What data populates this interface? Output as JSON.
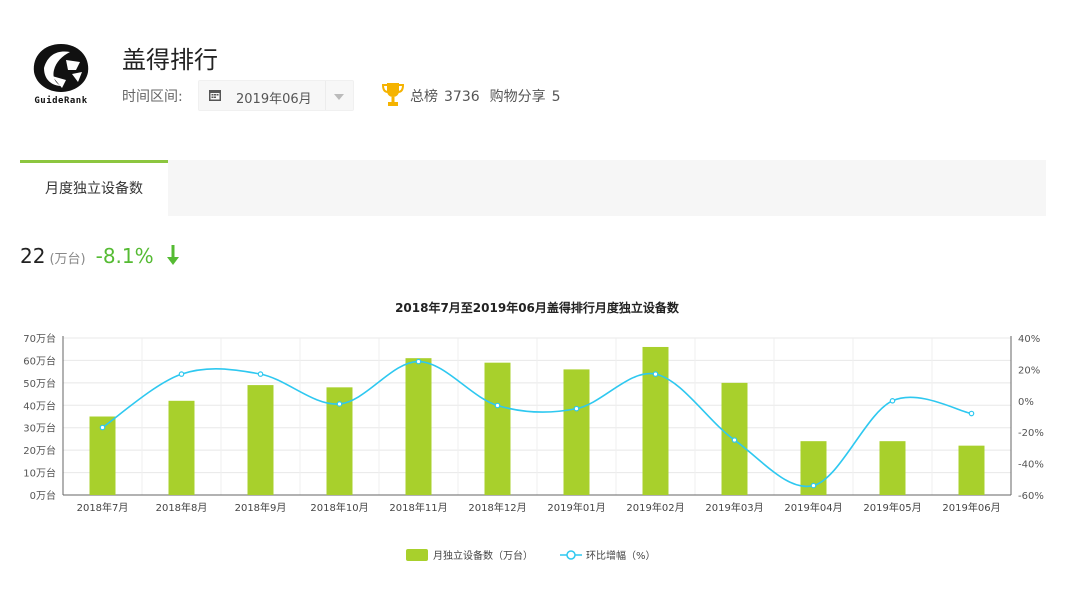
{
  "app": {
    "name": "盖得排行",
    "logo_text": "GuideRank"
  },
  "filter": {
    "label": "时间区间:",
    "date_value": "2019年06月",
    "calendar_icon": "calendar-icon",
    "dropdown_icon": "caret-down-icon"
  },
  "rank": {
    "icon": "trophy-icon",
    "total_label": "总榜",
    "total_value": "3736",
    "category_label": "购物分享",
    "category_value": "5",
    "accent": "#f5b300"
  },
  "tabs": [
    {
      "label": "月度独立设备数",
      "active": true
    }
  ],
  "metric": {
    "value": "22",
    "unit": "(万台)",
    "change": "-8.1%",
    "direction": "down",
    "color": "#55bb33"
  },
  "chart_data": {
    "type": "bar",
    "title": "2018年7月至2019年06月盖得排行月度独立设备数",
    "categories": [
      "2018年7月",
      "2018年8月",
      "2018年9月",
      "2018年10月",
      "2018年11月",
      "2018年12月",
      "2019年01月",
      "2019年02月",
      "2019年03月",
      "2019年04月",
      "2019年05月",
      "2019年06月"
    ],
    "series": [
      {
        "name": "月独立设备数（万台）",
        "type": "bar",
        "axis": "left",
        "color": "#a8d02c",
        "values": [
          35,
          42,
          49,
          48,
          61,
          59,
          56,
          66,
          50,
          24,
          24,
          22
        ]
      },
      {
        "name": "环比增幅（%）",
        "type": "line",
        "axis": "right",
        "color": "#2ec8f0",
        "values": [
          -17,
          17,
          17,
          -2,
          25,
          -3,
          -5,
          17,
          -25,
          -54,
          0,
          -8.1
        ]
      }
    ],
    "left_axis": {
      "min": 0,
      "max": 70,
      "ticks": [
        "0万台",
        "10万台",
        "20万台",
        "30万台",
        "40万台",
        "50万台",
        "60万台",
        "70万台"
      ]
    },
    "right_axis": {
      "min": -60,
      "max": 40,
      "ticks": [
        "-60%",
        "-40%",
        "-20%",
        "0%",
        "20%",
        "40%"
      ]
    },
    "grid": true,
    "legend_position": "bottom-center"
  }
}
